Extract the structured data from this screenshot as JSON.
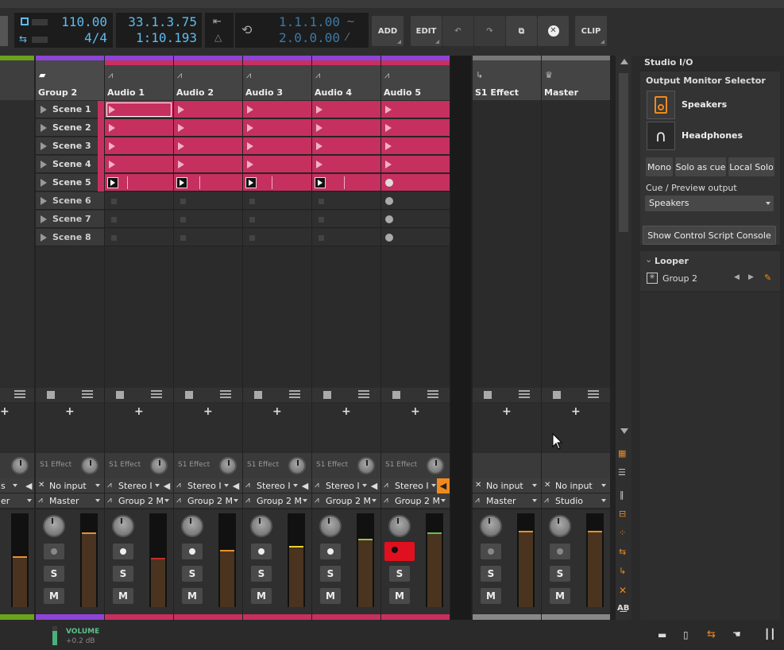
{
  "transport": {
    "tempo": "110.00",
    "signature": "4/4",
    "position": "33.1.3.75",
    "time": "1:10.193",
    "loop_start": "1.1.1.00",
    "loop_end": "2.0.0.00"
  },
  "toolbar": {
    "add_label": "ADD",
    "edit_label": "EDIT",
    "clip_label": "CLIP"
  },
  "group": {
    "name": "Group 2",
    "scenes": [
      "Scene 1",
      "Scene 2",
      "Scene 3",
      "Scene 4",
      "Scene 5",
      "Scene 6",
      "Scene 7",
      "Scene 8"
    ]
  },
  "tracks": [
    {
      "name": "Audio 1",
      "send": "S1 Effect",
      "input": "Stereo I",
      "output": "Group 2 Mas"
    },
    {
      "name": "Audio 2",
      "send": "S1 Effect",
      "input": "Stereo I",
      "output": "Group 2 Mas"
    },
    {
      "name": "Audio 3",
      "send": "S1 Effect",
      "input": "Stereo I",
      "output": "Group 2 Mas"
    },
    {
      "name": "Audio 4",
      "send": "S1 Effect",
      "input": "Stereo I",
      "output": "Group 2 Mas"
    },
    {
      "name": "Audio 5",
      "send": "S1 Effect",
      "input": "Stereo I",
      "output": "Group 2 Mas"
    }
  ],
  "group_strip": {
    "send": "S1 Effect",
    "input": "No input",
    "output": "Master"
  },
  "left_partial": {
    "input": "s",
    "output": "er"
  },
  "fx_track": {
    "name": "S1 Effect",
    "input": "No input",
    "output": "Master"
  },
  "master_track": {
    "name": "Master",
    "input": "No input",
    "output": "Studio"
  },
  "strip_buttons": {
    "solo": "S",
    "mute": "M"
  },
  "studio_io": {
    "title": "Studio I/O",
    "monitor_label": "Output Monitor Selector",
    "speakers": "Speakers",
    "headphones": "Headphones",
    "mono": "Mono",
    "solo_as_cue": "Solo as cue",
    "local_solo": "Local Solo",
    "cue_label": "Cue / Preview output",
    "cue_value": "Speakers",
    "console_button": "Show Control Script Console"
  },
  "looper": {
    "title": "Looper",
    "item": "Group 2"
  },
  "footer": {
    "volume_label": "VOLUME",
    "volume_value": "+0.2 dB"
  },
  "colors": {
    "clip_pink": "#c5305f",
    "group_purple": "#8e44d6",
    "green": "#6aa31c",
    "accent_orange": "#f08a1c",
    "lcd_blue": "#5dbcf0"
  }
}
